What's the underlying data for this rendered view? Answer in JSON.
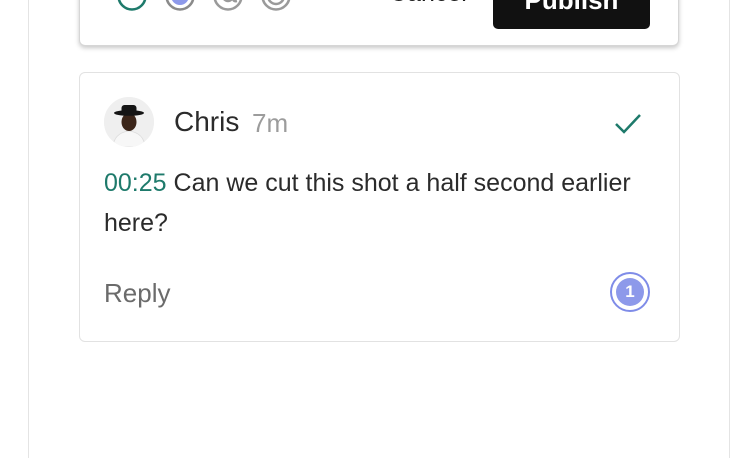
{
  "composer": {
    "cancel_label": "Cancel",
    "publish_label": "Publish",
    "tool_icons": [
      "clock-icon",
      "color-dot-icon",
      "mention-icon",
      "emoji-icon"
    ],
    "accent_color": "#1e7a6b"
  },
  "comment": {
    "author": "Chris",
    "time_ago": "7m",
    "timestamp": "00:25",
    "text": "Can we cut this shot a half second earlier here?",
    "resolved": true,
    "reply_label": "Reply",
    "count": "1",
    "timestamp_color": "#1e7a6b",
    "badge_color": "#8d99ea"
  }
}
